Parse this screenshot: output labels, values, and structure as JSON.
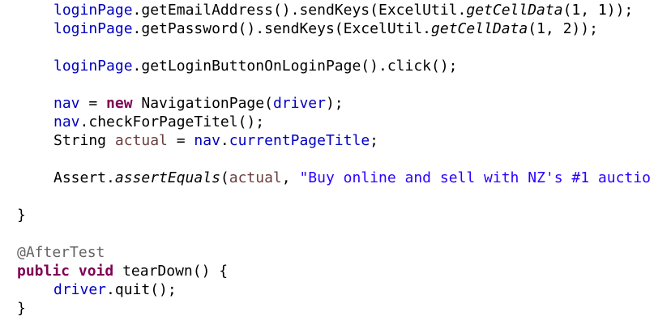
{
  "colors": {
    "field": "#0000c0",
    "local_variable": "#6a3e3e",
    "keyword": "#7f0055",
    "string": "#2a00ff",
    "annotation": "#646464",
    "default": "#000000",
    "background": "#ffffff"
  },
  "code": {
    "l1": {
      "a": "loginPage",
      "b": ".getEmailAddress().sendKeys(ExcelUtil.",
      "c": "getCellData",
      "d": "(1, 1));"
    },
    "l2": {
      "a": "loginPage",
      "b": ".getPassword().sendKeys(ExcelUtil.",
      "c": "getCellData",
      "d": "(1, 2));"
    },
    "l3": {
      "a": "loginPage",
      "b": ".getLoginButtonOnLoginPage().click();"
    },
    "l4": {
      "a": "nav",
      "b": " = ",
      "c": "new",
      "d": " NavigationPage(",
      "e": "driver",
      "f": ");"
    },
    "l5": {
      "a": "nav",
      "b": ".checkForPageTitel();"
    },
    "l6": {
      "a": "String ",
      "b": "actual",
      "c": " = ",
      "d": "nav",
      "e": ".",
      "f": "currentPageTitle",
      "g": ";"
    },
    "l7": {
      "a": "Assert.",
      "b": "assertEquals",
      "c": "(",
      "d": "actual",
      "e": ", ",
      "f": "\"Buy online and sell with NZ's #1 auctio"
    },
    "l8": {
      "a": "}"
    },
    "l9": {
      "a": "@AfterTest"
    },
    "l10": {
      "a": "public",
      "b": " ",
      "c": "void",
      "d": " tearDown() {"
    },
    "l11": {
      "a": "driver",
      "b": ".quit();"
    },
    "l12": {
      "a": "}"
    }
  }
}
